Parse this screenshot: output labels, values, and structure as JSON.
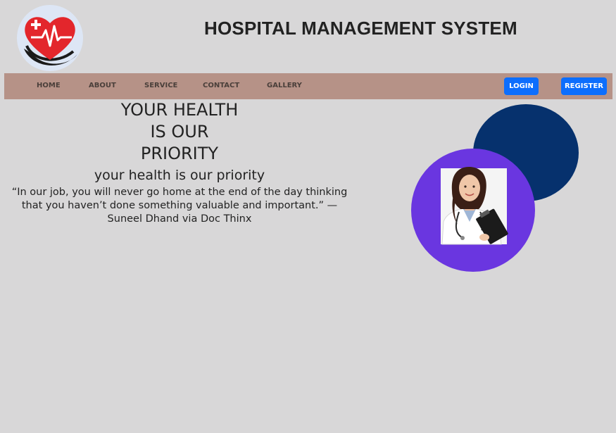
{
  "header": {
    "logo_icon": "heart-medical-logo-icon",
    "title": "HOSPITAL MANAGEMENT SYSTEM"
  },
  "nav": {
    "links": [
      "HOME",
      "ABOUT",
      "SERVICE",
      "CONTACT",
      "GALLERY"
    ],
    "login_label": "LOGIN",
    "register_label": "REGISTER"
  },
  "hero": {
    "headline_line1": "YOUR HEALTH",
    "headline_line2": "IS OUR",
    "headline_line3": "PRIORITY",
    "subheading": "your health is our priority",
    "quote": "“In our job, you will never go home at the end of the day thinking that you haven’t done something valuable and important.” — Suneel Dhand via Doc Thinx"
  },
  "decor": {
    "image_icon": "doctor-with-clipboard-image"
  },
  "colors": {
    "background": "#d8d7d8",
    "navbar": "#b69287",
    "button": "#0d6efd",
    "circle_navy": "#06316d",
    "circle_purple": "#6a36e0"
  }
}
